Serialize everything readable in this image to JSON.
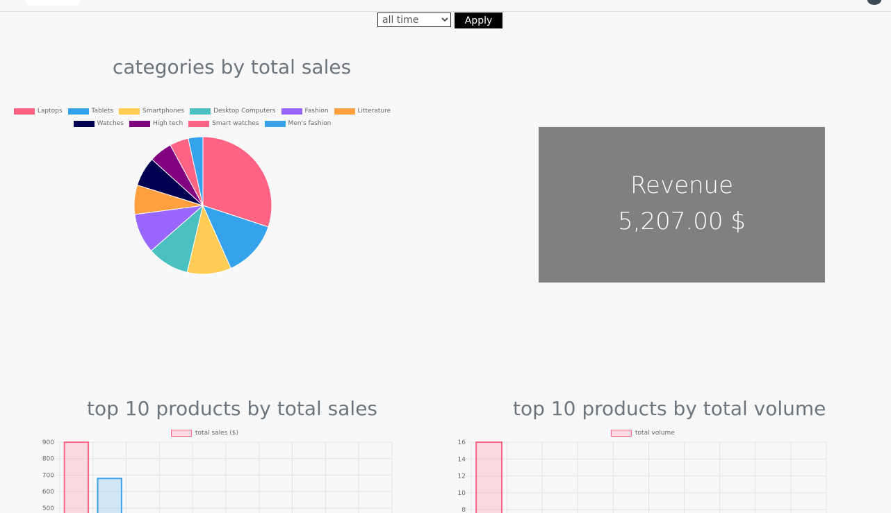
{
  "period_select": {
    "selected": "all time"
  },
  "apply_label": "Apply",
  "pie_title": "categories by total sales",
  "revenue": {
    "label": "Revenue",
    "value": "5,207.00 $"
  },
  "sales_title": "top 10 products by total sales",
  "volume_title": "top 10 products by total volume",
  "colors": {
    "laptops": "#ff6384",
    "tablets": "#36a2eb",
    "smartphones": "#ffcd56",
    "desktop": "#4bc0c0",
    "fashion": "#9966ff",
    "litterature": "#ff9f40",
    "watches": "#000051",
    "hightech": "#800080"
  },
  "chart_data": [
    {
      "type": "pie",
      "title": "categories by total sales",
      "legend_position": "top",
      "labels": [
        "Laptops",
        "Tablets",
        "Smartphones",
        "Desktop Computers",
        "Fashion",
        "Litterature",
        "Watches",
        "High tech",
        "Smart watches",
        "Men's fashion"
      ],
      "values": [
        30.5,
        13.5,
        10.5,
        10.0,
        9.5,
        7.0,
        7.0,
        5.5,
        4.5,
        3.5
      ],
      "colors": [
        "#ff6384",
        "#36a2eb",
        "#ffcd56",
        "#4bc0c0",
        "#9966ff",
        "#ff9f40",
        "#000051",
        "#800080",
        "#ff6384",
        "#36a2eb"
      ]
    },
    {
      "type": "bar",
      "title": "top 10 products by total sales",
      "series": [
        {
          "name": "total sales ($)",
          "values": [
            900,
            680
          ]
        }
      ],
      "y_ticks": [
        500,
        600,
        700,
        800,
        900
      ],
      "ylim": [
        470,
        900
      ],
      "grid": true,
      "bar_colors": [
        "#ff6384",
        "#36a2eb"
      ]
    },
    {
      "type": "bar",
      "title": "top 10 products by total volume",
      "series": [
        {
          "name": "total volume",
          "values": [
            16
          ]
        }
      ],
      "y_ticks": [
        8,
        10,
        12,
        14,
        16
      ],
      "ylim": [
        7.6,
        16
      ],
      "grid": true,
      "bar_colors": [
        "#ff6384"
      ]
    }
  ]
}
